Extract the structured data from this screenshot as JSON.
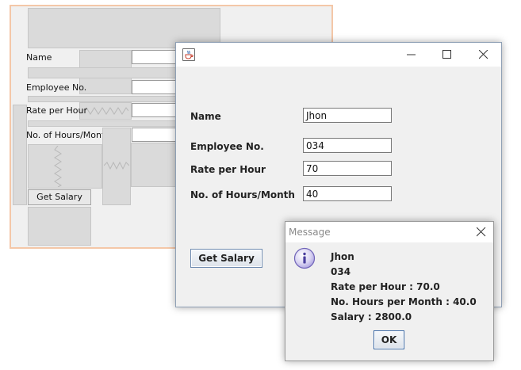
{
  "design_form": {
    "labels": [
      "Name",
      "Employee No.",
      "Rate per Hour",
      "No. of Hours/Month"
    ],
    "button_label": "Get Salary"
  },
  "main_window": {
    "title": "",
    "icon": "java-cup-icon",
    "controls": [
      "minimize-icon",
      "maximize-icon",
      "close-icon"
    ],
    "fields": [
      {
        "label": "Name",
        "value": "Jhon"
      },
      {
        "label": "Employee No.",
        "value": "034"
      },
      {
        "label": "Rate per Hour",
        "value": "70"
      },
      {
        "label": "No. of Hours/Month",
        "value": "40"
      }
    ],
    "button_label": "Get Salary"
  },
  "message_dialog": {
    "title": "Message",
    "icon": "info-icon",
    "lines": [
      "Jhon",
      "034",
      "Rate per Hour : 70.0",
      "No. Hours per Month : 40.0",
      "Salary : 2800.0"
    ],
    "ok_label": "OK"
  },
  "colors": {
    "accent": "#3c6aa5",
    "info_icon": "#6f63b8",
    "design_border": "#f4c7a8"
  }
}
